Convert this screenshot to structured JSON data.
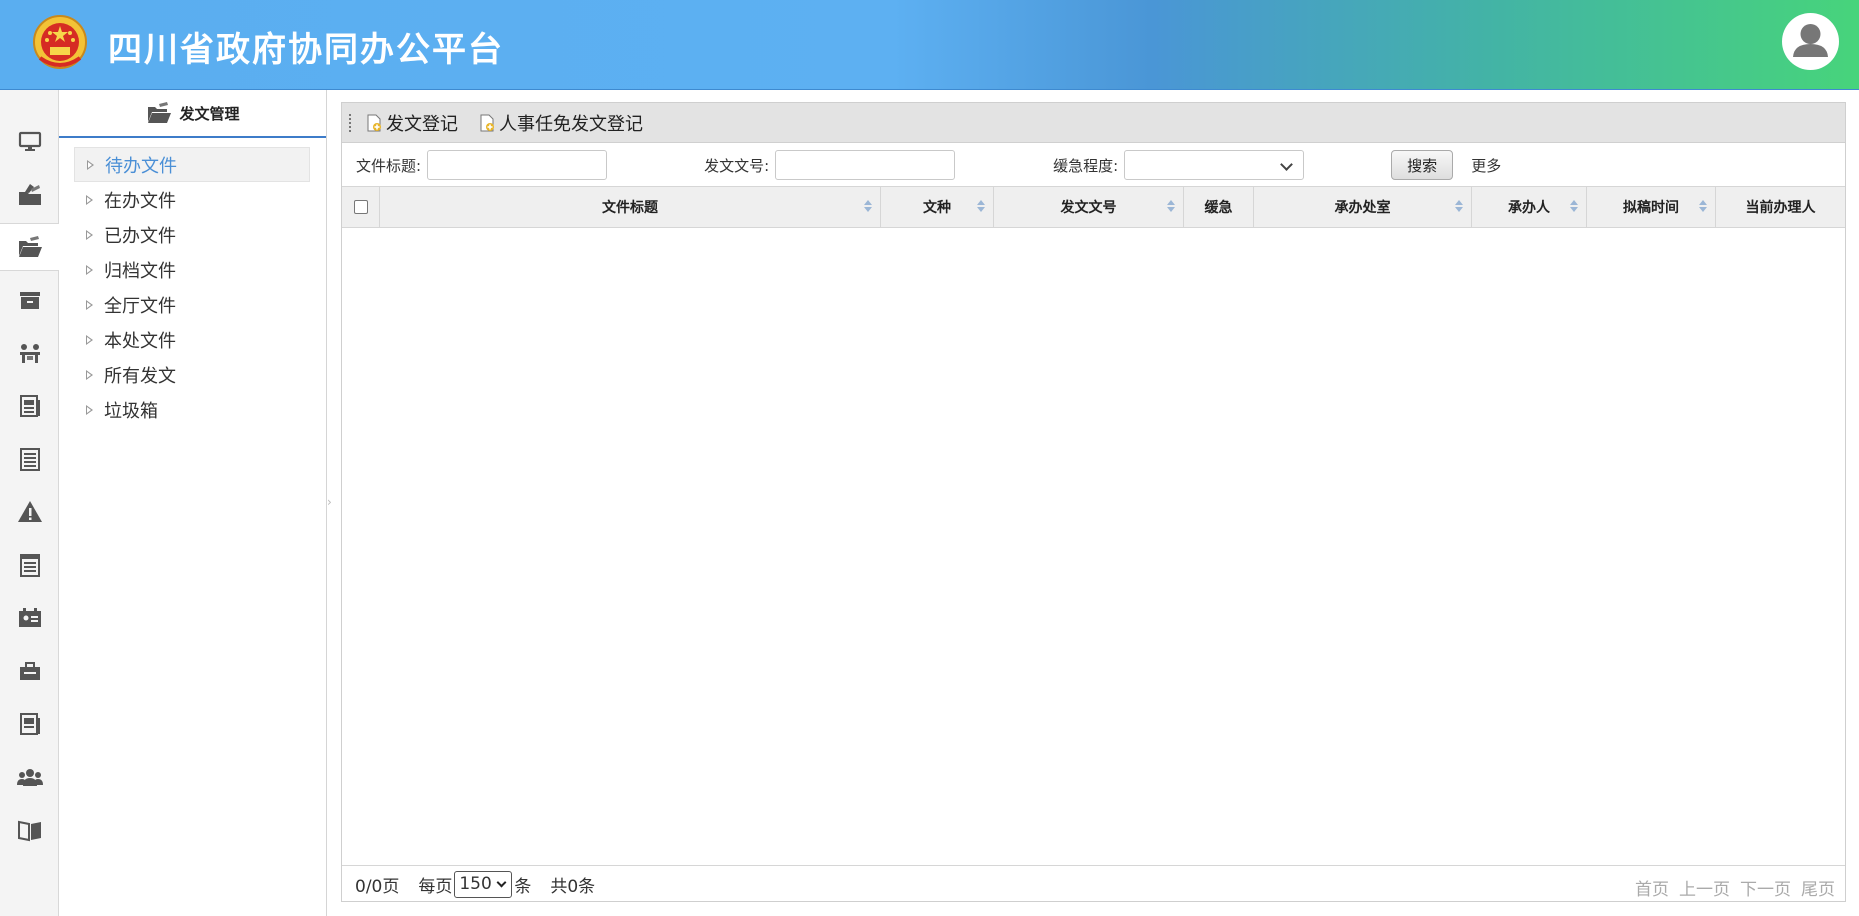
{
  "header": {
    "title": "四川省政府协同办公平台"
  },
  "rail": {
    "items": [
      {
        "icon": "desktop-icon"
      },
      {
        "icon": "document-send-icon"
      },
      {
        "icon": "folder-open-icon",
        "active": true
      },
      {
        "icon": "archive-icon"
      },
      {
        "icon": "meeting-icon"
      },
      {
        "icon": "news-icon"
      },
      {
        "icon": "list-icon"
      },
      {
        "icon": "warning-icon"
      },
      {
        "icon": "notes-icon"
      },
      {
        "icon": "calendar-card-icon"
      },
      {
        "icon": "briefcase-icon"
      },
      {
        "icon": "newspaper-icon"
      },
      {
        "icon": "users-icon"
      },
      {
        "icon": "book-icon"
      }
    ]
  },
  "sidebar": {
    "title": "发文管理",
    "items": [
      {
        "label": "待办文件"
      },
      {
        "label": "在办文件"
      },
      {
        "label": "已办文件"
      },
      {
        "label": "归档文件"
      },
      {
        "label": "全厅文件"
      },
      {
        "label": "本处文件"
      },
      {
        "label": "所有发文"
      },
      {
        "label": "垃圾箱"
      }
    ]
  },
  "toolbar": {
    "register_label": "发文登记",
    "personnel_register_label": "人事任免发文登记"
  },
  "filters": {
    "title_label": "文件标题:",
    "title_value": "",
    "doc_no_label": "发文文号:",
    "doc_no_value": "",
    "urgency_label": "缓急程度:",
    "urgency_value": "",
    "search_label": "搜索",
    "more_label": "更多"
  },
  "table": {
    "columns": [
      "文件标题",
      "文种",
      "发文文号",
      "缓急",
      "承办处室",
      "承办人",
      "拟稿时间",
      "当前办理人"
    ],
    "rows": []
  },
  "pager": {
    "page_info": "0/0页",
    "per_page_prefix": "每页",
    "per_page_value": "150",
    "per_page_suffix": "条",
    "total": "共0条",
    "first": "首页",
    "prev": "上一页",
    "next": "下一页",
    "last": "尾页"
  },
  "colors": {
    "header_gradient_start": "#5aaef0",
    "header_gradient_end": "#47d47b",
    "active_text": "#4a8fd6",
    "accent_border": "#3d7cc9"
  }
}
